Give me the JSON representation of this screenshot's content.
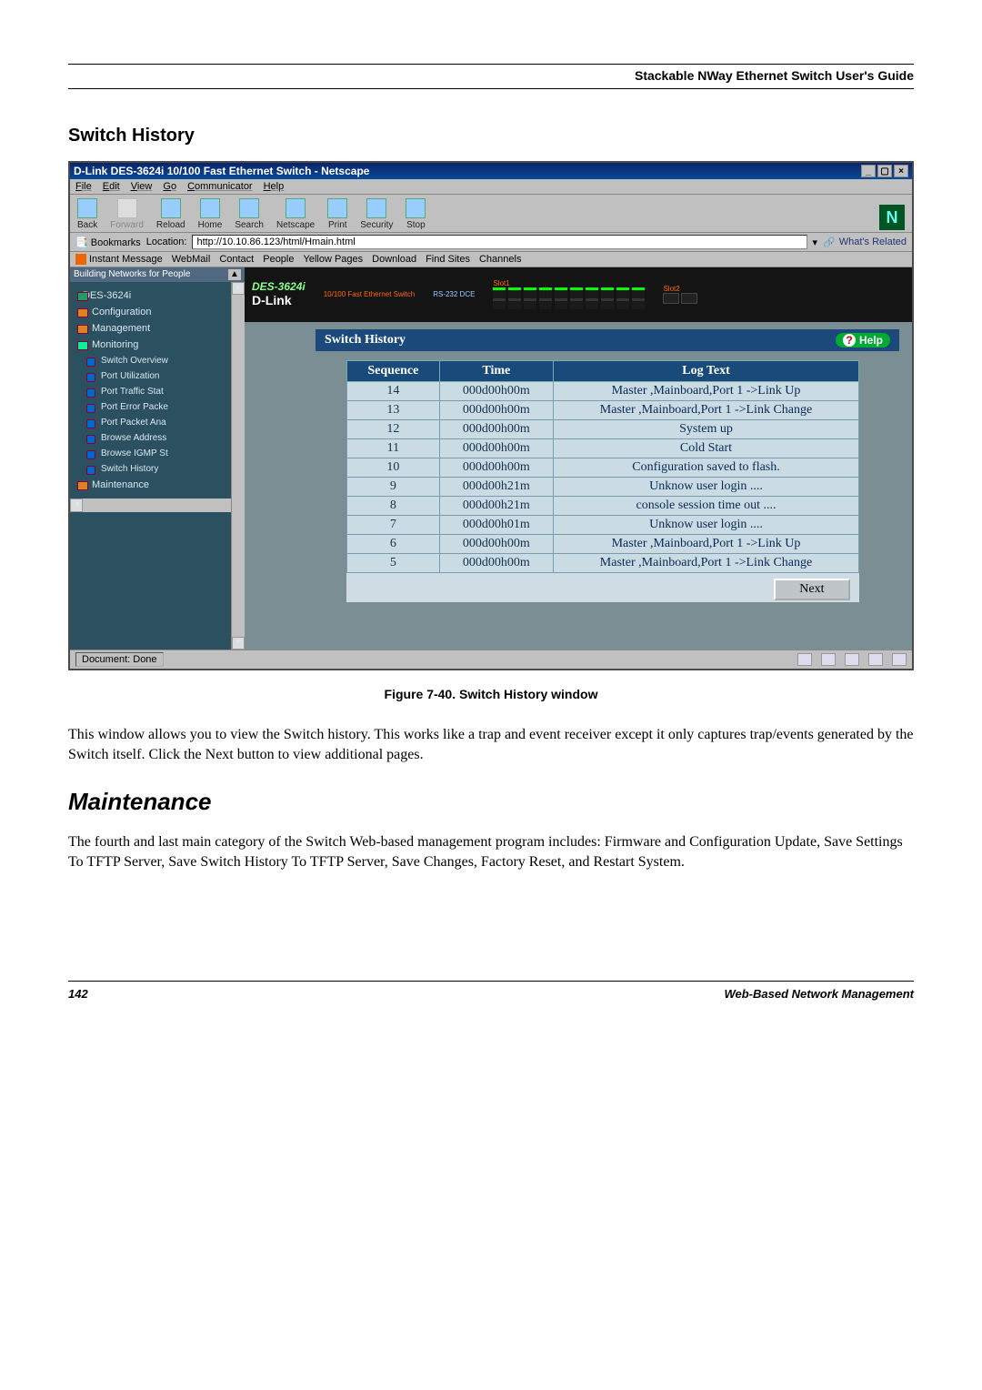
{
  "doc": {
    "guide_title": "Stackable NWay Ethernet Switch User's Guide",
    "page_number": "142",
    "footer_right": "Web-Based Network Management"
  },
  "section_heading": "Switch History",
  "figure_caption": "Figure 7-40.  Switch History window",
  "paragraph1": "This window allows you to view the Switch history. This works like a trap and event receiver except it only captures trap/events generated by the Switch itself. Click the Next button to view additional pages.",
  "maintenance_heading": "Maintenance",
  "paragraph2": "The fourth and last main category of the Switch Web-based management program includes: Firmware and Configuration Update, Save Settings To TFTP Server, Save Switch History To TFTP Server, Save Changes, Factory Reset, and Restart System.",
  "window": {
    "title": "D-Link DES-3624i 10/100 Fast Ethernet Switch - Netscape",
    "menus": [
      "File",
      "Edit",
      "View",
      "Go",
      "Communicator",
      "Help"
    ],
    "toolbar": {
      "back": "Back",
      "forward": "Forward",
      "reload": "Reload",
      "home": "Home",
      "search": "Search",
      "netscape": "Netscape",
      "print": "Print",
      "security": "Security",
      "stop": "Stop"
    },
    "location_label": "Location:",
    "bookmarks_label": "Bookmarks",
    "location_value": "http://10.10.86.123/html/Hmain.html",
    "whats_related": "What's Related",
    "linkbar": [
      "Instant Message",
      "WebMail",
      "Contact",
      "People",
      "Yellow Pages",
      "Download",
      "Find Sites",
      "Channels"
    ],
    "status": "Document: Done"
  },
  "sidebar": {
    "header": "Building Networks for People",
    "root": "DES-3624i",
    "items": [
      "Configuration",
      "Management",
      "Monitoring"
    ],
    "monitoring_children": [
      "Switch Overview",
      "Port Utilization",
      "Port Traffic Stat",
      "Port Error Packe",
      "Port Packet Ana",
      "Browse Address",
      "Browse IGMP St",
      "Switch History"
    ],
    "maintenance": "Maintenance"
  },
  "device": {
    "model": "DES-3624i",
    "subtitle": "10/100 Fast Ethernet Switch",
    "brand": "D-Link",
    "rs232": "RS-232 DCE",
    "slot1": "Slot1",
    "slot2": "Slot2"
  },
  "panel": {
    "title": "Switch History",
    "help": "Help",
    "columns": {
      "seq": "Sequence",
      "time": "Time",
      "log": "Log Text"
    },
    "rows": [
      {
        "seq": "14",
        "time": "000d00h00m",
        "log": "Master ,Mainboard,Port 1 ->Link Up"
      },
      {
        "seq": "13",
        "time": "000d00h00m",
        "log": "Master ,Mainboard,Port 1 ->Link Change"
      },
      {
        "seq": "12",
        "time": "000d00h00m",
        "log": "System up"
      },
      {
        "seq": "11",
        "time": "000d00h00m",
        "log": "Cold Start"
      },
      {
        "seq": "10",
        "time": "000d00h00m",
        "log": "Configuration saved to flash."
      },
      {
        "seq": "9",
        "time": "000d00h21m",
        "log": "Unknow user login ...."
      },
      {
        "seq": "8",
        "time": "000d00h21m",
        "log": "console session time out ...."
      },
      {
        "seq": "7",
        "time": "000d00h01m",
        "log": "Unknow user login ...."
      },
      {
        "seq": "6",
        "time": "000d00h00m",
        "log": "Master ,Mainboard,Port 1 ->Link Up"
      },
      {
        "seq": "5",
        "time": "000d00h00m",
        "log": "Master ,Mainboard,Port 1 ->Link Change"
      }
    ],
    "next": "Next"
  },
  "chart_data": {
    "type": "table",
    "title": "Switch History",
    "columns": [
      "Sequence",
      "Time",
      "Log Text"
    ],
    "rows": [
      [
        14,
        "000d00h00m",
        "Master ,Mainboard,Port 1 ->Link Up"
      ],
      [
        13,
        "000d00h00m",
        "Master ,Mainboard,Port 1 ->Link Change"
      ],
      [
        12,
        "000d00h00m",
        "System up"
      ],
      [
        11,
        "000d00h00m",
        "Cold Start"
      ],
      [
        10,
        "000d00h00m",
        "Configuration saved to flash."
      ],
      [
        9,
        "000d00h21m",
        "Unknow user login ...."
      ],
      [
        8,
        "000d00h21m",
        "console session time out ...."
      ],
      [
        7,
        "000d00h01m",
        "Unknow user login ...."
      ],
      [
        6,
        "000d00h00m",
        "Master ,Mainboard,Port 1 ->Link Up"
      ],
      [
        5,
        "000d00h00m",
        "Master ,Mainboard,Port 1 ->Link Change"
      ]
    ]
  }
}
